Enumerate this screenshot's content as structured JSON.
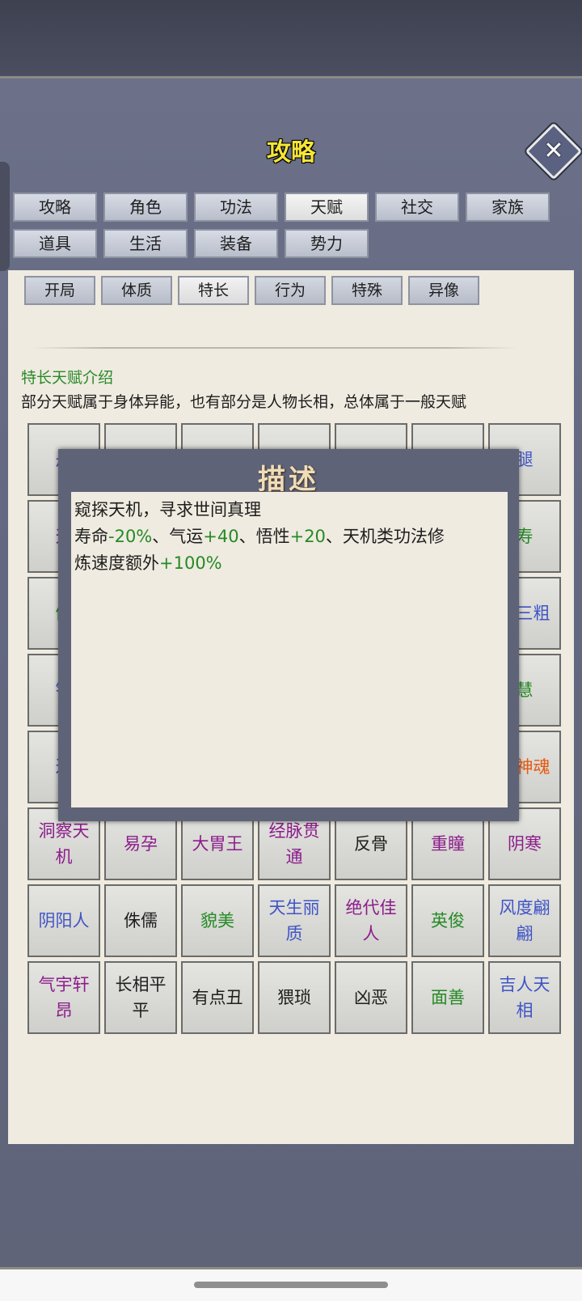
{
  "header": {
    "title": "攻略",
    "close_icon": "close-icon"
  },
  "tabs": [
    {
      "label": "攻略",
      "active": false
    },
    {
      "label": "角色",
      "active": false
    },
    {
      "label": "功法",
      "active": false
    },
    {
      "label": "天赋",
      "active": true
    },
    {
      "label": "社交",
      "active": false
    },
    {
      "label": "家族",
      "active": false
    },
    {
      "label": "道具",
      "active": false
    },
    {
      "label": "生活",
      "active": false
    },
    {
      "label": "装备",
      "active": false
    },
    {
      "label": "势力",
      "active": false
    }
  ],
  "subtabs": [
    {
      "label": "开局",
      "active": false
    },
    {
      "label": "体质",
      "active": false
    },
    {
      "label": "特长",
      "active": true
    },
    {
      "label": "行为",
      "active": false
    },
    {
      "label": "特殊",
      "active": false
    },
    {
      "label": "异像",
      "active": false
    }
  ],
  "intro": {
    "title": "特长天赋介绍",
    "description": "部分天赋属于身体异能，也有部分是人物长相，总体属于一般天赋"
  },
  "colors": {
    "blue": "#3f54c6",
    "purple": "#8c1c8c",
    "green": "#258a25",
    "black": "#1e1e1e",
    "orange": "#e55a14"
  },
  "grid": [
    {
      "label": "丹",
      "color": "blue"
    },
    {
      "label": "",
      "color": "black"
    },
    {
      "label": "",
      "color": "black"
    },
    {
      "label": "",
      "color": "black"
    },
    {
      "label": "",
      "color": "black"
    },
    {
      "label": "",
      "color": "black"
    },
    {
      "label": "腿",
      "color": "blue"
    },
    {
      "label": "天",
      "color": "purple"
    },
    {
      "label": "",
      "color": "black"
    },
    {
      "label": "",
      "color": "black"
    },
    {
      "label": "",
      "color": "black"
    },
    {
      "label": "",
      "color": "black"
    },
    {
      "label": "",
      "color": "black"
    },
    {
      "label": "寿",
      "color": "green"
    },
    {
      "label": "健",
      "color": "green"
    },
    {
      "label": "",
      "color": "black"
    },
    {
      "label": "",
      "color": "black"
    },
    {
      "label": "",
      "color": "black"
    },
    {
      "label": "",
      "color": "black"
    },
    {
      "label": "",
      "color": "black"
    },
    {
      "label": "大三粗",
      "color": "blue"
    },
    {
      "label": "钢",
      "color": "blue"
    },
    {
      "label": "",
      "color": "black"
    },
    {
      "label": "",
      "color": "black"
    },
    {
      "label": "",
      "color": "black"
    },
    {
      "label": "",
      "color": "black"
    },
    {
      "label": "",
      "color": "black"
    },
    {
      "label": "慧",
      "color": "green"
    },
    {
      "label": "过",
      "color": "blue"
    },
    {
      "label": "",
      "color": "black"
    },
    {
      "label": "",
      "color": "black"
    },
    {
      "label": "",
      "color": "black"
    },
    {
      "label": "",
      "color": "black"
    },
    {
      "label": "",
      "color": "black"
    },
    {
      "label": "能神魂",
      "color": "orange"
    },
    {
      "label": "洞察天机",
      "color": "purple"
    },
    {
      "label": "易孕",
      "color": "purple"
    },
    {
      "label": "大胃王",
      "color": "purple"
    },
    {
      "label": "经脉贯通",
      "color": "purple"
    },
    {
      "label": "反骨",
      "color": "black"
    },
    {
      "label": "重瞳",
      "color": "purple"
    },
    {
      "label": "阴寒",
      "color": "purple"
    },
    {
      "label": "阴阳人",
      "color": "blue"
    },
    {
      "label": "侏儒",
      "color": "black"
    },
    {
      "label": "貌美",
      "color": "green"
    },
    {
      "label": "天生丽质",
      "color": "blue"
    },
    {
      "label": "绝代佳人",
      "color": "purple"
    },
    {
      "label": "英俊",
      "color": "green"
    },
    {
      "label": "风度翩翩",
      "color": "blue"
    },
    {
      "label": "气宇轩昂",
      "color": "purple"
    },
    {
      "label": "长相平平",
      "color": "black"
    },
    {
      "label": "有点丑",
      "color": "black"
    },
    {
      "label": "猥琐",
      "color": "black"
    },
    {
      "label": "凶恶",
      "color": "black"
    },
    {
      "label": "面善",
      "color": "green"
    },
    {
      "label": "吉人天相",
      "color": "blue"
    }
  ],
  "modal": {
    "title": "描述",
    "line1": "窥探天机，寻求世间真理",
    "line2_parts": [
      "寿命",
      "-20%",
      "、气运",
      "+40",
      "、悟性",
      "+20",
      "、天机类功法修"
    ],
    "line3_parts": [
      "炼速度额外",
      "+100%"
    ]
  }
}
